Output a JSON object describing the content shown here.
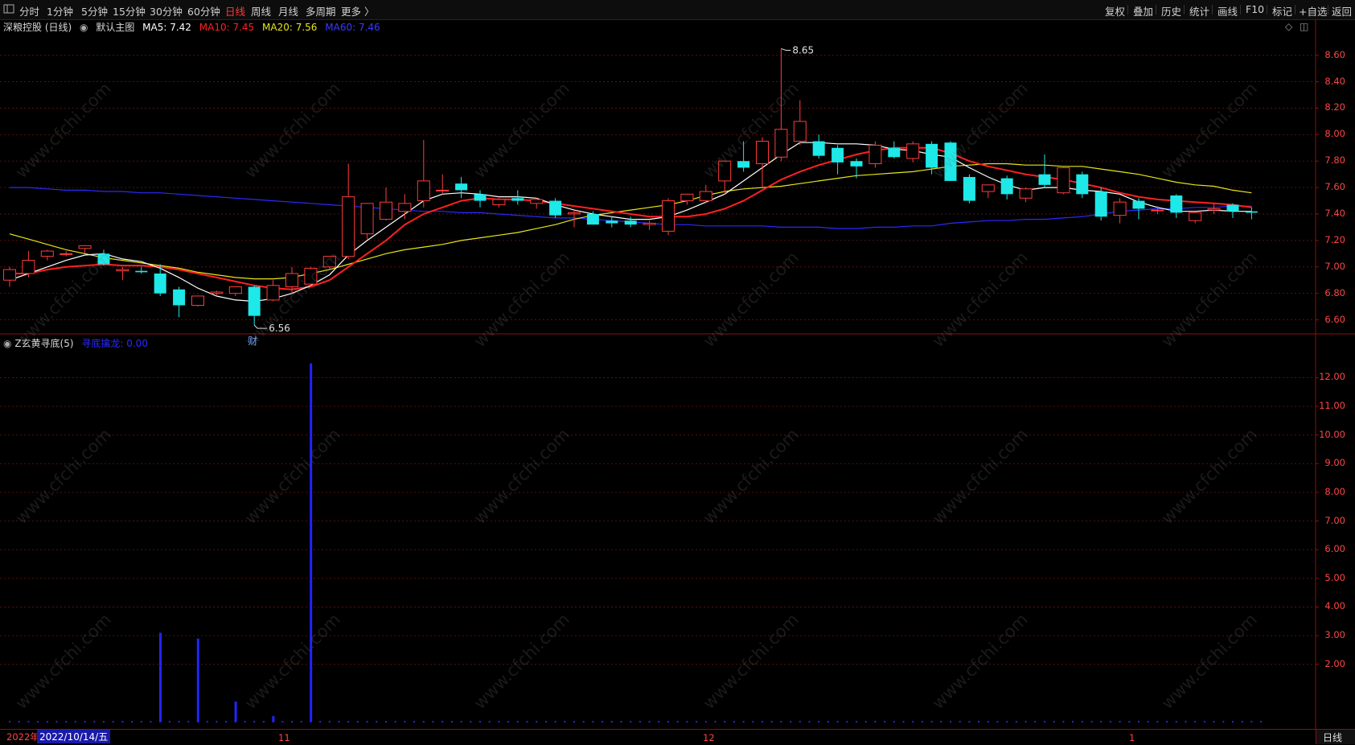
{
  "toolbar": {
    "periods": [
      "分时",
      "1分钟",
      "5分钟",
      "15分钟",
      "30分钟",
      "60分钟",
      "日线",
      "周线",
      "月线",
      "多周期",
      "更多 〉"
    ],
    "active_period": "日线",
    "right_tools": [
      "复权",
      "叠加",
      "历史",
      "统计",
      "画线",
      "F10",
      "标记",
      "+自选",
      "返回"
    ]
  },
  "main_panel": {
    "stock_title": "深粮控股 (日线)",
    "template_label": "默认主图",
    "ma5": "MA5: 7.42",
    "ma10": "MA10: 7.45",
    "ma20": "MA20: 7.56",
    "ma60": "MA60: 7.46",
    "colors": {
      "ma5": "#ffffff",
      "ma10": "#ff2020",
      "ma20": "#e6e61a",
      "ma60": "#2a2aff",
      "up": "#ff3b3b",
      "down": "#1ee8e8",
      "axis": "#ff4545"
    },
    "price_ticks": [
      "8.60",
      "8.40",
      "8.20",
      "8.00",
      "7.80",
      "7.60",
      "7.40",
      "7.20",
      "7.00",
      "6.80",
      "6.60"
    ],
    "high_label": "8.65",
    "low_label": "6.56",
    "finance_marker": "财"
  },
  "indicator_panel": {
    "name": "Z玄黄寻底(5)",
    "line_label": "寻底擒龙: 0.00",
    "ticks": [
      "12.00",
      "11.00",
      "10.00",
      "9.00",
      "8.00",
      "7.00",
      "6.00",
      "5.00",
      "4.00",
      "3.00",
      "2.00"
    ]
  },
  "date_axis": {
    "cursor_date": "2022/10/14/五",
    "year_label": "2022年",
    "months": [
      "11",
      "12",
      "1"
    ],
    "period_label": "日线"
  },
  "watermark": "www.cfchi.com",
  "chart_data": {
    "type": "candlestick",
    "ylim": [
      6.5,
      8.75
    ],
    "candles": [
      {
        "o": 6.9,
        "h": 7.0,
        "l": 6.85,
        "c": 6.98
      },
      {
        "o": 6.95,
        "h": 7.12,
        "l": 6.92,
        "c": 7.05
      },
      {
        "o": 7.08,
        "h": 7.13,
        "l": 7.05,
        "c": 7.12
      },
      {
        "o": 7.1,
        "h": 7.12,
        "l": 7.08,
        "c": 7.1
      },
      {
        "o": 7.14,
        "h": 7.16,
        "l": 7.1,
        "c": 7.16
      },
      {
        "o": 7.1,
        "h": 7.13,
        "l": 7.01,
        "c": 7.02
      },
      {
        "o": 6.97,
        "h": 7.0,
        "l": 6.9,
        "c": 6.98
      },
      {
        "o": 6.97,
        "h": 7.0,
        "l": 6.95,
        "c": 6.96
      },
      {
        "o": 6.95,
        "h": 7.02,
        "l": 6.78,
        "c": 6.8
      },
      {
        "o": 6.83,
        "h": 6.85,
        "l": 6.62,
        "c": 6.71
      },
      {
        "o": 6.71,
        "h": 6.78,
        "l": 6.7,
        "c": 6.78
      },
      {
        "o": 6.8,
        "h": 6.82,
        "l": 6.78,
        "c": 6.81
      },
      {
        "o": 6.8,
        "h": 6.85,
        "l": 6.78,
        "c": 6.85
      },
      {
        "o": 6.85,
        "h": 6.86,
        "l": 6.56,
        "c": 6.63
      },
      {
        "o": 6.75,
        "h": 6.9,
        "l": 6.74,
        "c": 6.86
      },
      {
        "o": 6.85,
        "h": 7.0,
        "l": 6.8,
        "c": 6.95
      },
      {
        "o": 6.87,
        "h": 7.0,
        "l": 6.85,
        "c": 6.99
      },
      {
        "o": 7.0,
        "h": 7.08,
        "l": 6.98,
        "c": 7.08
      },
      {
        "o": 7.08,
        "h": 7.78,
        "l": 7.06,
        "c": 7.53
      },
      {
        "o": 7.25,
        "h": 7.45,
        "l": 7.21,
        "c": 7.48
      },
      {
        "o": 7.36,
        "h": 7.6,
        "l": 7.35,
        "c": 7.49
      },
      {
        "o": 7.42,
        "h": 7.55,
        "l": 7.36,
        "c": 7.48
      },
      {
        "o": 7.5,
        "h": 7.96,
        "l": 7.45,
        "c": 7.65
      },
      {
        "o": 7.58,
        "h": 7.7,
        "l": 7.55,
        "c": 7.58
      },
      {
        "o": 7.63,
        "h": 7.68,
        "l": 7.52,
        "c": 7.58
      },
      {
        "o": 7.55,
        "h": 7.58,
        "l": 7.45,
        "c": 7.5
      },
      {
        "o": 7.47,
        "h": 7.52,
        "l": 7.45,
        "c": 7.51
      },
      {
        "o": 7.52,
        "h": 7.58,
        "l": 7.47,
        "c": 7.5
      },
      {
        "o": 7.48,
        "h": 7.52,
        "l": 7.44,
        "c": 7.51
      },
      {
        "o": 7.5,
        "h": 7.52,
        "l": 7.37,
        "c": 7.39
      },
      {
        "o": 7.4,
        "h": 7.43,
        "l": 7.3,
        "c": 7.41
      },
      {
        "o": 7.4,
        "h": 7.42,
        "l": 7.32,
        "c": 7.32
      },
      {
        "o": 7.35,
        "h": 7.38,
        "l": 7.3,
        "c": 7.33
      },
      {
        "o": 7.35,
        "h": 7.38,
        "l": 7.3,
        "c": 7.32
      },
      {
        "o": 7.32,
        "h": 7.35,
        "l": 7.28,
        "c": 7.33
      },
      {
        "o": 7.27,
        "h": 7.52,
        "l": 7.24,
        "c": 7.5
      },
      {
        "o": 7.5,
        "h": 7.55,
        "l": 7.47,
        "c": 7.55
      },
      {
        "o": 7.5,
        "h": 7.62,
        "l": 7.48,
        "c": 7.57
      },
      {
        "o": 7.65,
        "h": 7.8,
        "l": 7.55,
        "c": 7.8
      },
      {
        "o": 7.8,
        "h": 7.95,
        "l": 7.72,
        "c": 7.75
      },
      {
        "o": 7.78,
        "h": 7.98,
        "l": 7.6,
        "c": 7.95
      },
      {
        "o": 7.83,
        "h": 8.65,
        "l": 7.8,
        "c": 8.04
      },
      {
        "o": 7.95,
        "h": 8.26,
        "l": 7.92,
        "c": 8.1
      },
      {
        "o": 7.95,
        "h": 8.0,
        "l": 7.82,
        "c": 7.84
      },
      {
        "o": 7.9,
        "h": 7.92,
        "l": 7.7,
        "c": 7.79
      },
      {
        "o": 7.8,
        "h": 7.82,
        "l": 7.67,
        "c": 7.76
      },
      {
        "o": 7.78,
        "h": 7.95,
        "l": 7.75,
        "c": 7.92
      },
      {
        "o": 7.9,
        "h": 7.95,
        "l": 7.82,
        "c": 7.83
      },
      {
        "o": 7.82,
        "h": 7.95,
        "l": 7.79,
        "c": 7.93
      },
      {
        "o": 7.93,
        "h": 7.95,
        "l": 7.7,
        "c": 7.75
      },
      {
        "o": 7.94,
        "h": 7.95,
        "l": 7.65,
        "c": 7.65
      },
      {
        "o": 7.68,
        "h": 7.7,
        "l": 7.48,
        "c": 7.5
      },
      {
        "o": 7.57,
        "h": 7.62,
        "l": 7.52,
        "c": 7.62
      },
      {
        "o": 7.67,
        "h": 7.69,
        "l": 7.51,
        "c": 7.55
      },
      {
        "o": 7.52,
        "h": 7.6,
        "l": 7.49,
        "c": 7.59
      },
      {
        "o": 7.7,
        "h": 7.85,
        "l": 7.6,
        "c": 7.62
      },
      {
        "o": 7.56,
        "h": 7.76,
        "l": 7.55,
        "c": 7.75
      },
      {
        "o": 7.7,
        "h": 7.72,
        "l": 7.52,
        "c": 7.55
      },
      {
        "o": 7.57,
        "h": 7.6,
        "l": 7.35,
        "c": 7.38
      },
      {
        "o": 7.39,
        "h": 7.52,
        "l": 7.33,
        "c": 7.49
      },
      {
        "o": 7.5,
        "h": 7.52,
        "l": 7.36,
        "c": 7.44
      },
      {
        "o": 7.43,
        "h": 7.46,
        "l": 7.4,
        "c": 7.43
      },
      {
        "o": 7.54,
        "h": 7.55,
        "l": 7.37,
        "c": 7.41
      },
      {
        "o": 7.35,
        "h": 7.42,
        "l": 7.33,
        "c": 7.41
      },
      {
        "o": 7.43,
        "h": 7.48,
        "l": 7.4,
        "c": 7.44
      },
      {
        "o": 7.47,
        "h": 7.48,
        "l": 7.37,
        "c": 7.42
      },
      {
        "o": 7.42,
        "h": 7.45,
        "l": 7.36,
        "c": 7.41
      }
    ],
    "ma5": [
      6.9,
      6.95,
      7.0,
      7.05,
      7.09,
      7.1,
      7.06,
      7.04,
      6.99,
      6.92,
      6.84,
      6.78,
      6.75,
      6.74,
      6.76,
      6.8,
      6.86,
      6.94,
      7.09,
      7.2,
      7.3,
      7.4,
      7.5,
      7.55,
      7.56,
      7.55,
      7.53,
      7.53,
      7.52,
      7.47,
      7.43,
      7.4,
      7.38,
      7.36,
      7.36,
      7.38,
      7.43,
      7.49,
      7.55,
      7.65,
      7.75,
      7.85,
      7.94,
      7.94,
      7.93,
      7.93,
      7.92,
      7.89,
      7.88,
      7.85,
      7.83,
      7.75,
      7.68,
      7.62,
      7.58,
      7.6,
      7.6,
      7.58,
      7.57,
      7.55,
      7.49,
      7.45,
      7.42,
      7.42,
      7.43,
      7.42,
      7.42
    ],
    "ma10": [
      6.95,
      6.95,
      6.98,
      7.0,
      7.01,
      7.02,
      7.01,
      7.01,
      7.0,
      6.98,
      6.95,
      6.92,
      6.89,
      6.86,
      6.84,
      6.83,
      6.85,
      6.9,
      7.0,
      7.1,
      7.2,
      7.32,
      7.4,
      7.45,
      7.5,
      7.52,
      7.51,
      7.51,
      7.5,
      7.48,
      7.46,
      7.44,
      7.42,
      7.4,
      7.38,
      7.38,
      7.38,
      7.4,
      7.44,
      7.5,
      7.58,
      7.66,
      7.72,
      7.77,
      7.81,
      7.85,
      7.88,
      7.9,
      7.9,
      7.9,
      7.86,
      7.8,
      7.76,
      7.73,
      7.7,
      7.68,
      7.66,
      7.63,
      7.6,
      7.56,
      7.53,
      7.51,
      7.5,
      7.49,
      7.48,
      7.47,
      7.45
    ],
    "ma20": [
      7.25,
      7.21,
      7.17,
      7.13,
      7.1,
      7.07,
      7.05,
      7.03,
      7.01,
      6.99,
      6.96,
      6.94,
      6.92,
      6.91,
      6.91,
      6.92,
      6.95,
      6.98,
      7.02,
      7.06,
      7.1,
      7.13,
      7.15,
      7.17,
      7.2,
      7.22,
      7.24,
      7.26,
      7.29,
      7.32,
      7.36,
      7.39,
      7.41,
      7.43,
      7.45,
      7.47,
      7.5,
      7.54,
      7.57,
      7.59,
      7.6,
      7.61,
      7.63,
      7.65,
      7.67,
      7.69,
      7.7,
      7.71,
      7.72,
      7.74,
      7.76,
      7.77,
      7.78,
      7.78,
      7.77,
      7.77,
      7.76,
      7.76,
      7.74,
      7.72,
      7.7,
      7.67,
      7.64,
      7.62,
      7.61,
      7.58,
      7.56
    ],
    "ma60": [
      7.6,
      7.6,
      7.59,
      7.58,
      7.58,
      7.57,
      7.57,
      7.56,
      7.56,
      7.55,
      7.54,
      7.53,
      7.52,
      7.51,
      7.5,
      7.49,
      7.48,
      7.47,
      7.46,
      7.45,
      7.44,
      7.43,
      7.42,
      7.42,
      7.41,
      7.41,
      7.4,
      7.39,
      7.38,
      7.37,
      7.37,
      7.36,
      7.35,
      7.34,
      7.33,
      7.32,
      7.32,
      7.31,
      7.31,
      7.31,
      7.31,
      7.3,
      7.3,
      7.3,
      7.29,
      7.29,
      7.3,
      7.3,
      7.31,
      7.31,
      7.33,
      7.34,
      7.35,
      7.35,
      7.36,
      7.36,
      7.37,
      7.38,
      7.4,
      7.42,
      7.43,
      7.44,
      7.44,
      7.45,
      7.45,
      7.46,
      7.46
    ],
    "indicator_ylim": [
      0,
      13.5
    ],
    "indicator_values": [
      0,
      0,
      0,
      0,
      0,
      0,
      0,
      0,
      3.1,
      0,
      2.9,
      0,
      0.7,
      0,
      0.2,
      0,
      12.5,
      0,
      0,
      0,
      0,
      0,
      0,
      0,
      0,
      0,
      0,
      0,
      0,
      0,
      0,
      0,
      0,
      0,
      0,
      0,
      0,
      0,
      0,
      0,
      0,
      0,
      0,
      0,
      0,
      0,
      0,
      0,
      0,
      0,
      0,
      0,
      0,
      0,
      0,
      0,
      0,
      0,
      0,
      0,
      0,
      0,
      0,
      0,
      0,
      0,
      0
    ]
  }
}
